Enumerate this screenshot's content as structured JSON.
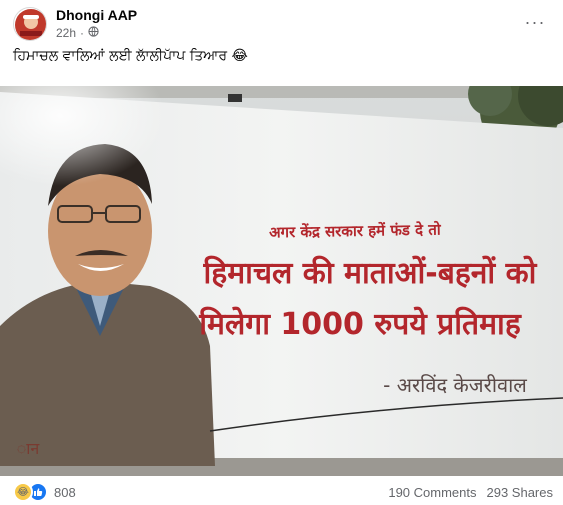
{
  "post": {
    "page_name": "Dhongi AAP",
    "time": "22h",
    "audience_icon": "globe-icon",
    "caption": "ਹਿਮਾਚਲ ਵਾਲਿਆਂ ਲਈ ਲਾੱਲੀਪਾੱਪ ਤਿਆਰ 😂"
  },
  "billboard": {
    "line1": "अगर केंद्र सरकार हमें फंड दे तो",
    "line2": "हिमाचल की माताओं-बहनों को",
    "line3": "मिलेगा 1000 रुपये प्रतिमाह",
    "signature": "- अरविंद केजरीवाल",
    "partial_text": "ान"
  },
  "footer": {
    "reaction_count": "808",
    "comments": "190 Comments",
    "shares": "293 Shares"
  },
  "colors": {
    "billboard_text": "#b3262c",
    "signature_text": "#5a4a48",
    "meta_text": "#65676b",
    "like_blue": "#1877f2"
  }
}
